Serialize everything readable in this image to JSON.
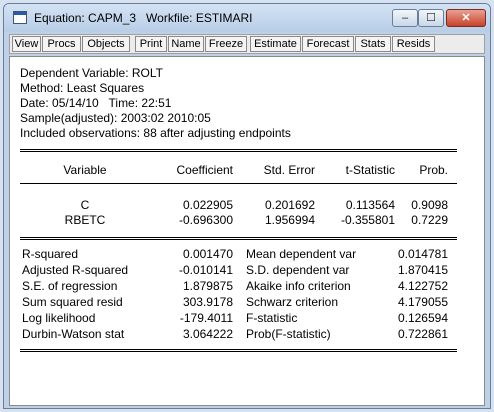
{
  "window": {
    "title": "Equation: CAPM_3   Workfile: ESTIMARI",
    "controls": {
      "minimize": "‒",
      "maximize": "☐",
      "close": "✕"
    }
  },
  "toolbar": {
    "buttons": [
      "View",
      "Procs",
      "Objects",
      "Print",
      "Name",
      "Freeze",
      "Estimate",
      "Forecast",
      "Stats",
      "Resids"
    ]
  },
  "header": {
    "dependent": "Dependent Variable: ROLT",
    "method": "Method: Least Squares",
    "date": "Date: 05/14/10   Time: 22:51",
    "sample": "Sample(adjusted): 2003:02 2010:05",
    "observations": "Included observations: 88 after adjusting endpoints"
  },
  "coef_table": {
    "columns": [
      "Variable",
      "Coefficient",
      "Std. Error",
      "t-Statistic",
      "Prob."
    ],
    "rows": [
      [
        "C",
        "0.022905",
        "0.201692",
        "0.113564",
        "0.9098"
      ],
      [
        "RBETC",
        "-0.696300",
        "1.956994",
        "-0.355801",
        "0.7229"
      ]
    ]
  },
  "stats_table": {
    "rows": [
      [
        "R-squared",
        "0.001470",
        "Mean dependent var",
        "0.014781"
      ],
      [
        "Adjusted R-squared",
        "-0.010141",
        "S.D. dependent var",
        "1.870415"
      ],
      [
        "S.E. of regression",
        "1.879875",
        "Akaike info criterion",
        "4.122752"
      ],
      [
        "Sum squared resid",
        "303.9178",
        "Schwarz criterion",
        "4.179055"
      ],
      [
        "Log likelihood",
        "-179.4011",
        "F-statistic",
        "0.126594"
      ],
      [
        "Durbin-Watson stat",
        "3.064222",
        "Prob(F-statistic)",
        "0.722861"
      ]
    ]
  }
}
